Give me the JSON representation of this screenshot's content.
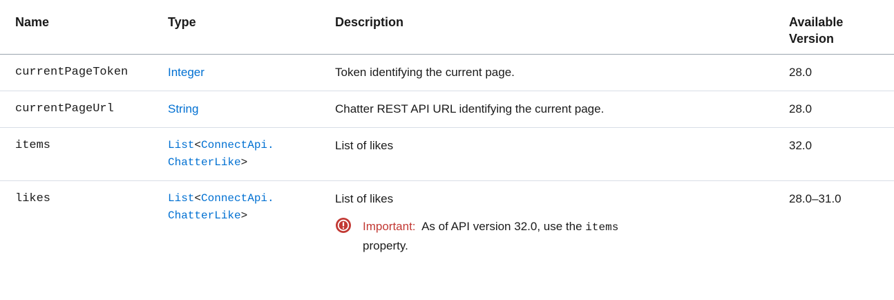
{
  "table": {
    "headers": {
      "name": "Name",
      "type": "Type",
      "description": "Description",
      "version_line1": "Available",
      "version_line2": "Version"
    },
    "rows": [
      {
        "name": "currentPageToken",
        "type": "Integer",
        "description": "Token identifying the current page.",
        "version": "28.0"
      },
      {
        "name": "currentPageUrl",
        "type": "String",
        "description": "Chatter REST API URL identifying the current page.",
        "version": "28.0"
      },
      {
        "name": "items",
        "type_list": "List",
        "type_lt": "<",
        "type_connect": "ConnectApi.",
        "type_like": "ChatterLike",
        "type_gt": ">",
        "description": "List of likes",
        "version": "32.0"
      },
      {
        "name": "likes",
        "type_list": "List",
        "type_lt": "<",
        "type_connect": "ConnectApi.",
        "type_like": "ChatterLike",
        "type_gt": ">",
        "description": "List of likes",
        "version": "28.0–31.0",
        "note": {
          "label": "Important:",
          "text_before": "As of API version 32.0, use the",
          "code": "items",
          "text_after": "property."
        }
      }
    ]
  },
  "colors": {
    "link": "#0070d2",
    "important": "#c23934",
    "divider": "#d8dde6"
  },
  "icons": {
    "important": "exclamation-circle-icon"
  }
}
